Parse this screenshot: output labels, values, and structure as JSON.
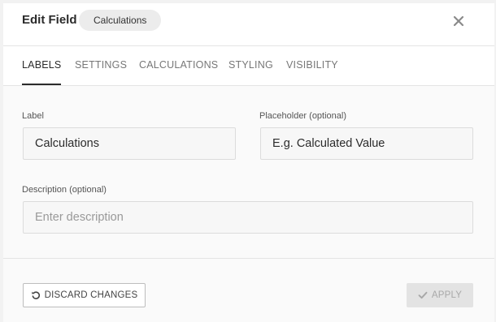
{
  "dialog": {
    "title": "Edit Field",
    "chip": "Calculations"
  },
  "tabs": [
    {
      "label": "LABELS",
      "active": true
    },
    {
      "label": "SETTINGS",
      "active": false
    },
    {
      "label": "CALCULATIONS",
      "active": false
    },
    {
      "label": "STYLING",
      "active": false
    },
    {
      "label": "VISIBILITY",
      "active": false
    }
  ],
  "form": {
    "label_field": {
      "label": "Label",
      "value": "Calculations"
    },
    "placeholder_field": {
      "label": "Placeholder (optional)",
      "value": "E.g. Calculated Value"
    },
    "description_field": {
      "label": "Description (optional)",
      "value": "",
      "placeholder": "Enter description"
    }
  },
  "footer": {
    "discard_label": "DISCARD CHANGES",
    "apply_label": "APPLY"
  },
  "icons": {
    "close": "close-icon",
    "discard": "undo-icon",
    "apply": "check-icon"
  },
  "colors": {
    "text": "#2b2b2b",
    "muted": "#777777",
    "apply_disabled_bg": "#e3e3e3",
    "apply_disabled_text": "#a8a8a8"
  }
}
